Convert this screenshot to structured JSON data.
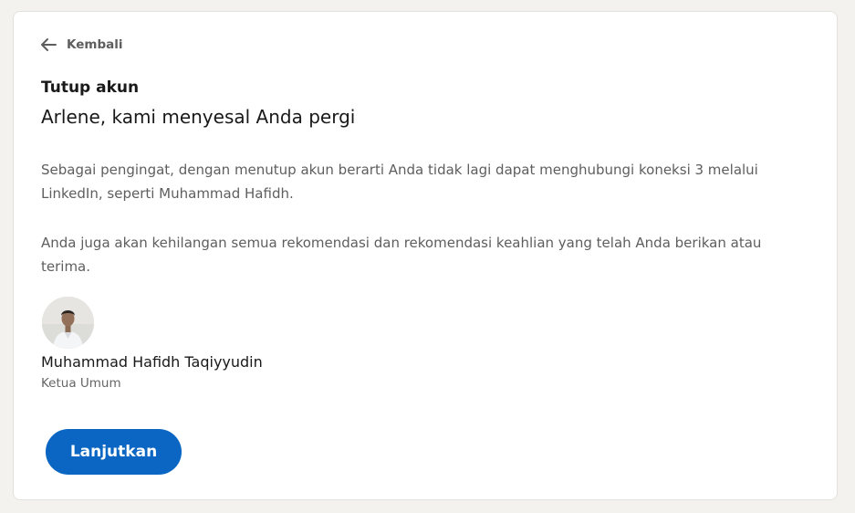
{
  "navigation": {
    "back_label": "Kembali",
    "back_icon": "arrow-left-icon"
  },
  "header": {
    "section_title": "Tutup akun",
    "headline": "Arlene, kami menyesal Anda pergi"
  },
  "body": {
    "paragraph_1": "Sebagai pengingat, dengan menutup akun berarti Anda tidak lagi dapat menghubungi koneksi 3 melalui LinkedIn, seperti Muhammad Hafidh.",
    "paragraph_2": "Anda juga akan kehilangan semua rekomendasi dan rekomendasi keahlian yang telah Anda berikan atau terima."
  },
  "connection": {
    "name": "Muhammad Hafidh Taqiyyudin",
    "title": "Ketua Umum",
    "avatar_icon": "avatar-photo"
  },
  "actions": {
    "continue_label": "Lanjutkan"
  },
  "colors": {
    "primary_button": "#0a66c2",
    "page_background": "#f4f2ee",
    "card_background": "#ffffff",
    "secondary_text": "#5e5e5e"
  }
}
